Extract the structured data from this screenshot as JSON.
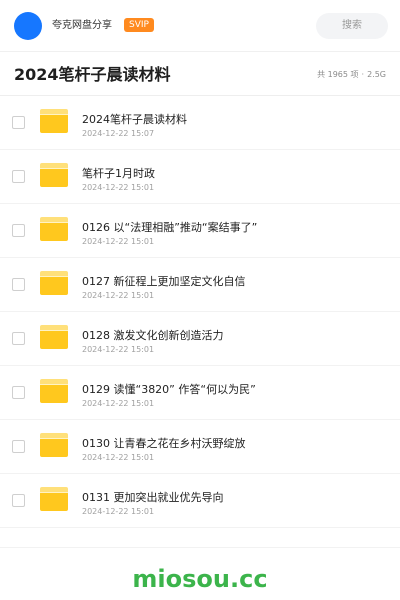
{
  "topbar": {
    "username": "夸克网盘分享",
    "badge": "SVIP",
    "search_placeholder": "搜索"
  },
  "header": {
    "title": "2024笔杆子晨读材料",
    "count": "共 1965 项",
    "size": "2.5G"
  },
  "files": [
    {
      "name": "2024笔杆子晨读材料",
      "date": "2024-12-22 15:07"
    },
    {
      "name": "笔杆子1月时政",
      "date": "2024-12-22 15:01"
    },
    {
      "name": "0126 以“法理相融”推动“案结事了”",
      "date": "2024-12-22 15:01"
    },
    {
      "name": "0127 新征程上更加坚定文化自信",
      "date": "2024-12-22 15:01"
    },
    {
      "name": "0128 激发文化创新创造活力",
      "date": "2024-12-22 15:01"
    },
    {
      "name": "0129 读懂“3820” 作答“何以为民”",
      "date": "2024-12-22 15:01"
    },
    {
      "name": "0130 让青春之花在乡村沃野绽放",
      "date": "2024-12-22 15:01"
    },
    {
      "name": "0131 更加突出就业优先导向",
      "date": "2024-12-22 15:01"
    }
  ],
  "watermark": "miosou.cc",
  "colors": {
    "accent": "#1677ff",
    "badge": "#ff8a1f",
    "folder": "#ffc81e",
    "watermark": "#3cb44b"
  }
}
